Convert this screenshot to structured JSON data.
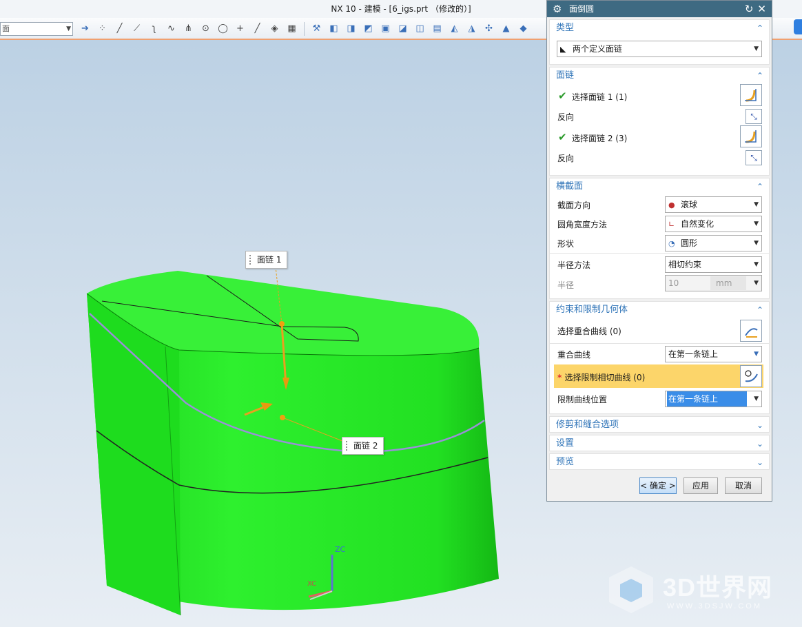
{
  "window": {
    "title": "NX 10 - 建模 - [6_igs.prt （修改的）]"
  },
  "toolbar": {
    "filter_value": "面",
    "icons": [
      "arrow-right-icon",
      "point-cloud-icon",
      "line-icon",
      "line-icon",
      "curve-icon",
      "spline-icon",
      "arc-tangent-icon",
      "circle-center-icon",
      "circle-icon",
      "plus-icon",
      "line-icon",
      "surface-icon",
      "grid-icon",
      "wrench-icon",
      "extrude-icon",
      "revolve-icon",
      "hole-icon",
      "feature-icon",
      "block-icon",
      "solid-icon",
      "pattern-icon",
      "mirror-icon",
      "blend-icon",
      "chamfer-icon",
      "draft-icon",
      "shell-icon"
    ]
  },
  "viewport": {
    "callout1": "面链 1",
    "callout2": "面链 2",
    "axis_zc": "ZC",
    "axis_xc": "XC",
    "body_color": "#22ee22"
  },
  "watermark": {
    "text": "3D世界网",
    "url": "WWW.3DSJW.COM"
  },
  "dialog": {
    "title": "面倒圆",
    "type_section": {
      "header": "类型",
      "value": "两个定义面链"
    },
    "chain_section": {
      "header": "面链",
      "select1": "选择面链 1 (1)",
      "reverse1": "反向",
      "select2": "选择面链 2 (3)",
      "reverse2": "反向"
    },
    "cross_section": {
      "header": "横截面",
      "orientation_label": "截面方向",
      "orientation_value": "滚球",
      "width_label": "圆角宽度方法",
      "width_value": "自然变化",
      "shape_label": "形状",
      "shape_value": "圆形",
      "radius_method_label": "半径方法",
      "radius_method_value": "相切约束",
      "radius_label": "半径",
      "radius_value": "10",
      "radius_unit": "mm"
    },
    "constraint_section": {
      "header": "约束和限制几何体",
      "coincident_select": "选择重合曲线 (0)",
      "coincident_label": "重合曲线",
      "coincident_value": "在第一条链上",
      "tangent_select": "选择限制相切曲线 (0)",
      "limit_label": "限制曲线位置",
      "limit_value": "在第一条链上"
    },
    "trim_section": {
      "header": "修剪和缝合选项"
    },
    "settings_section": {
      "header": "设置"
    },
    "preview_section": {
      "header": "预览"
    },
    "buttons": {
      "ok": "< 确定 >",
      "apply": "应用",
      "cancel": "取消"
    }
  }
}
